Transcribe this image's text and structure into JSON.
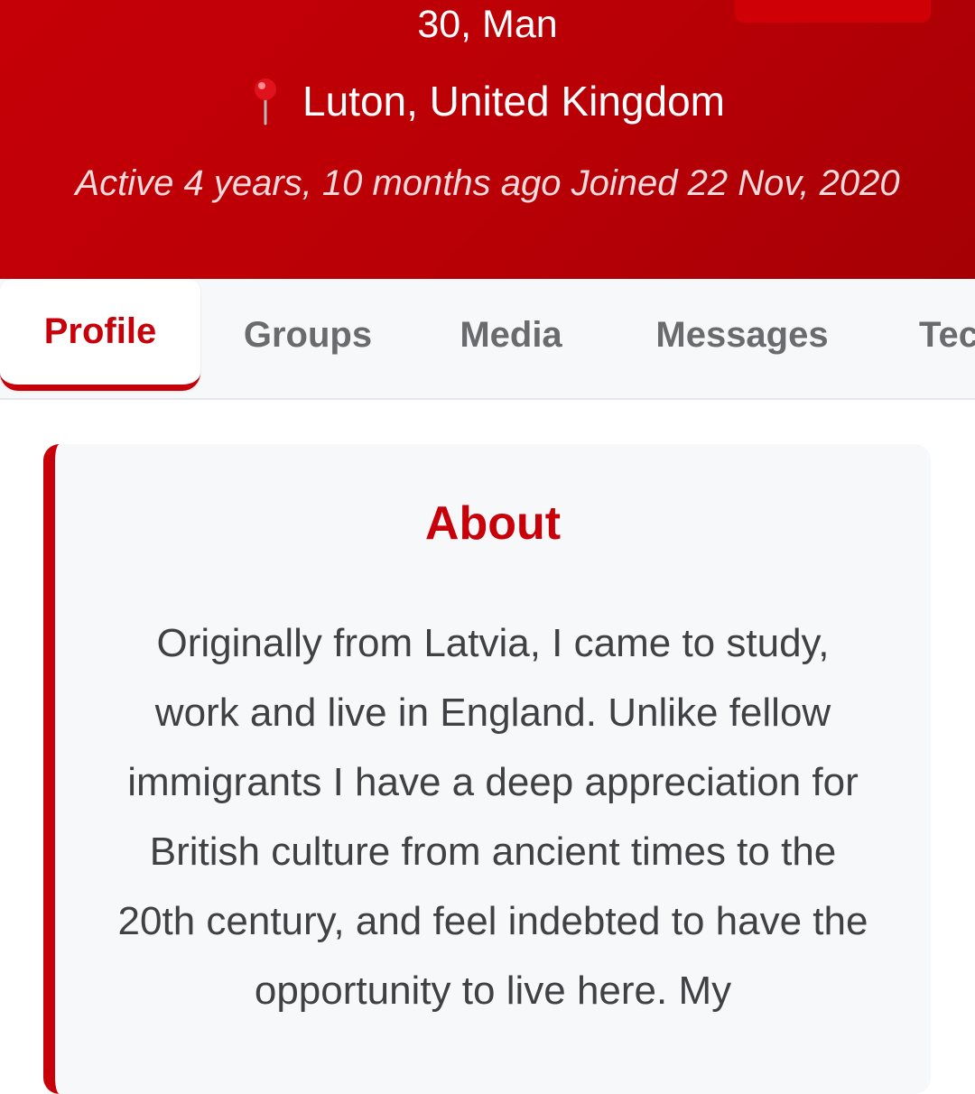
{
  "profile": {
    "age_gender": "30, Man",
    "location": "Luton, United Kingdom",
    "location_icon": "pushpin-icon",
    "activity": "Active 4 years, 10 months ago Joined 22 Nov, 2020"
  },
  "tabs": [
    {
      "label": "Profile",
      "active": true
    },
    {
      "label": "Groups",
      "active": false
    },
    {
      "label": "Media",
      "active": false
    },
    {
      "label": "Messages",
      "active": false
    },
    {
      "label": "Tec",
      "active": false
    }
  ],
  "about": {
    "title": "About",
    "text": "Originally from Latvia, I came to study, work and live in England. Unlike fellow immigrants I have a deep appreciation for British culture from ancient times to the 20th century, and feel indebted to have the opportunity to live here. My"
  },
  "colors": {
    "accent": "#c70009",
    "header_bg": "#b80006",
    "tab_bar_bg": "#f7f8fa",
    "text": "#3f4145"
  }
}
